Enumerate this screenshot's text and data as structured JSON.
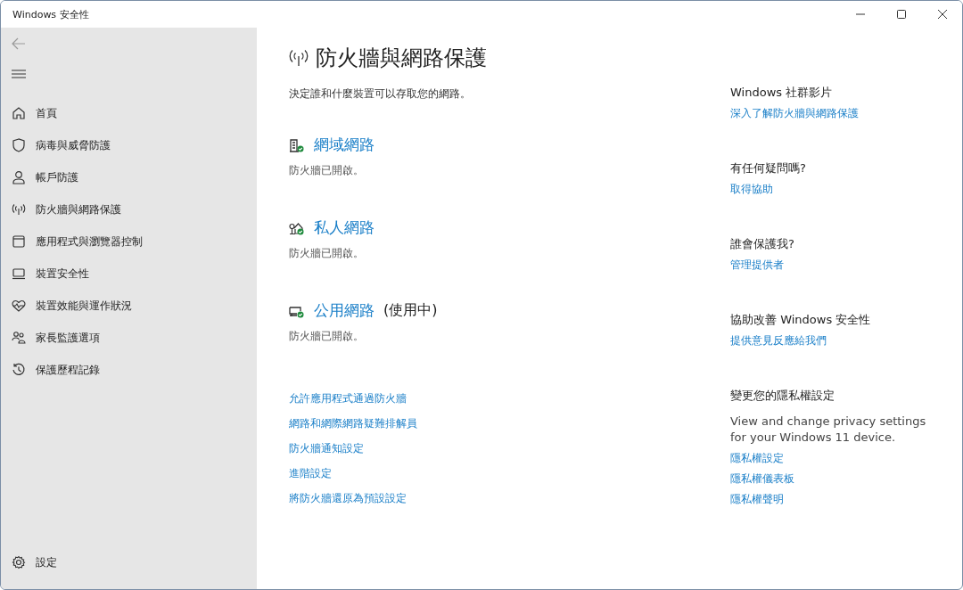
{
  "window": {
    "title": "Windows 安全性"
  },
  "sidebar": {
    "items": [
      {
        "label": "首頁",
        "kind": "home"
      },
      {
        "label": "病毒與威脅防護",
        "kind": "virus"
      },
      {
        "label": "帳戶防護",
        "kind": "account"
      },
      {
        "label": "防火牆與網路保護",
        "kind": "firewall"
      },
      {
        "label": "應用程式與瀏覽器控制",
        "kind": "app"
      },
      {
        "label": "裝置安全性",
        "kind": "device"
      },
      {
        "label": "裝置效能與運作狀況",
        "kind": "health"
      },
      {
        "label": "家長監護選項",
        "kind": "family"
      },
      {
        "label": "保護歷程記錄",
        "kind": "history"
      }
    ],
    "settings": {
      "label": "設定"
    }
  },
  "main": {
    "title": "防火牆與網路保護",
    "subtitle": "決定誰和什麼裝置可以存取您的網路。",
    "networks": [
      {
        "kind": "domain",
        "name": "網域網路",
        "status": "防火牆已開啟。"
      },
      {
        "kind": "private",
        "name": "私人網路",
        "status": "防火牆已開啟。"
      },
      {
        "kind": "public",
        "name": "公用網路",
        "note": "(使用中)",
        "status": "防火牆已開啟。"
      }
    ],
    "links": [
      "允許應用程式通過防火牆",
      "網路和網際網路疑難排解員",
      "防火牆通知設定",
      "進階設定",
      "將防火牆還原為預設設定"
    ]
  },
  "side_panel": [
    {
      "heading": "Windows 社群影片",
      "links": [
        "深入了解防火牆與網路保護"
      ]
    },
    {
      "heading": "有任何疑問嗎?",
      "links": [
        "取得協助"
      ]
    },
    {
      "heading": "誰會保護我?",
      "links": [
        "管理提供者"
      ]
    },
    {
      "heading": "協助改善 Windows 安全性",
      "links": [
        "提供意見反應給我們"
      ]
    },
    {
      "heading": "變更您的隱私權設定",
      "text": "View and change privacy settings for your Windows 11 device.",
      "links": [
        "隱私權設定",
        "隱私權儀表板",
        "隱私權聲明"
      ]
    }
  ]
}
